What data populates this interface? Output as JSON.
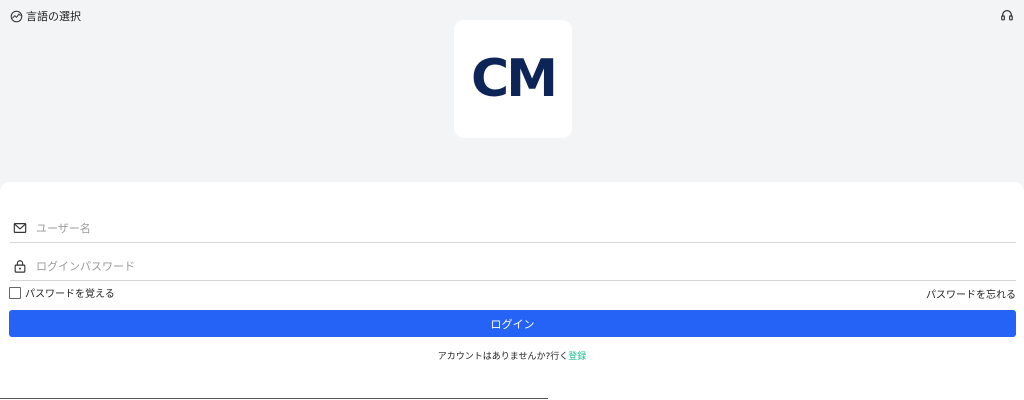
{
  "header": {
    "language_label": "言語の選択",
    "language_icon": "globe-icon",
    "support_icon": "headset-icon"
  },
  "logo": {
    "text": "CM",
    "color": "#0d2456"
  },
  "form": {
    "username_placeholder": "ユーザー名",
    "username_value": "",
    "password_placeholder": "ログインパスワード",
    "password_value": "",
    "remember_label": "パスワードを覚える",
    "remember_checked": false,
    "forgot_label": "パスワードを忘れる",
    "login_label": "ログイン",
    "signup_prompt": "アカウントはありませんか?行く",
    "signup_link": "登録"
  },
  "colors": {
    "accent": "#2563f6",
    "link": "#1fbf8f",
    "background": "#f2f4f5"
  }
}
